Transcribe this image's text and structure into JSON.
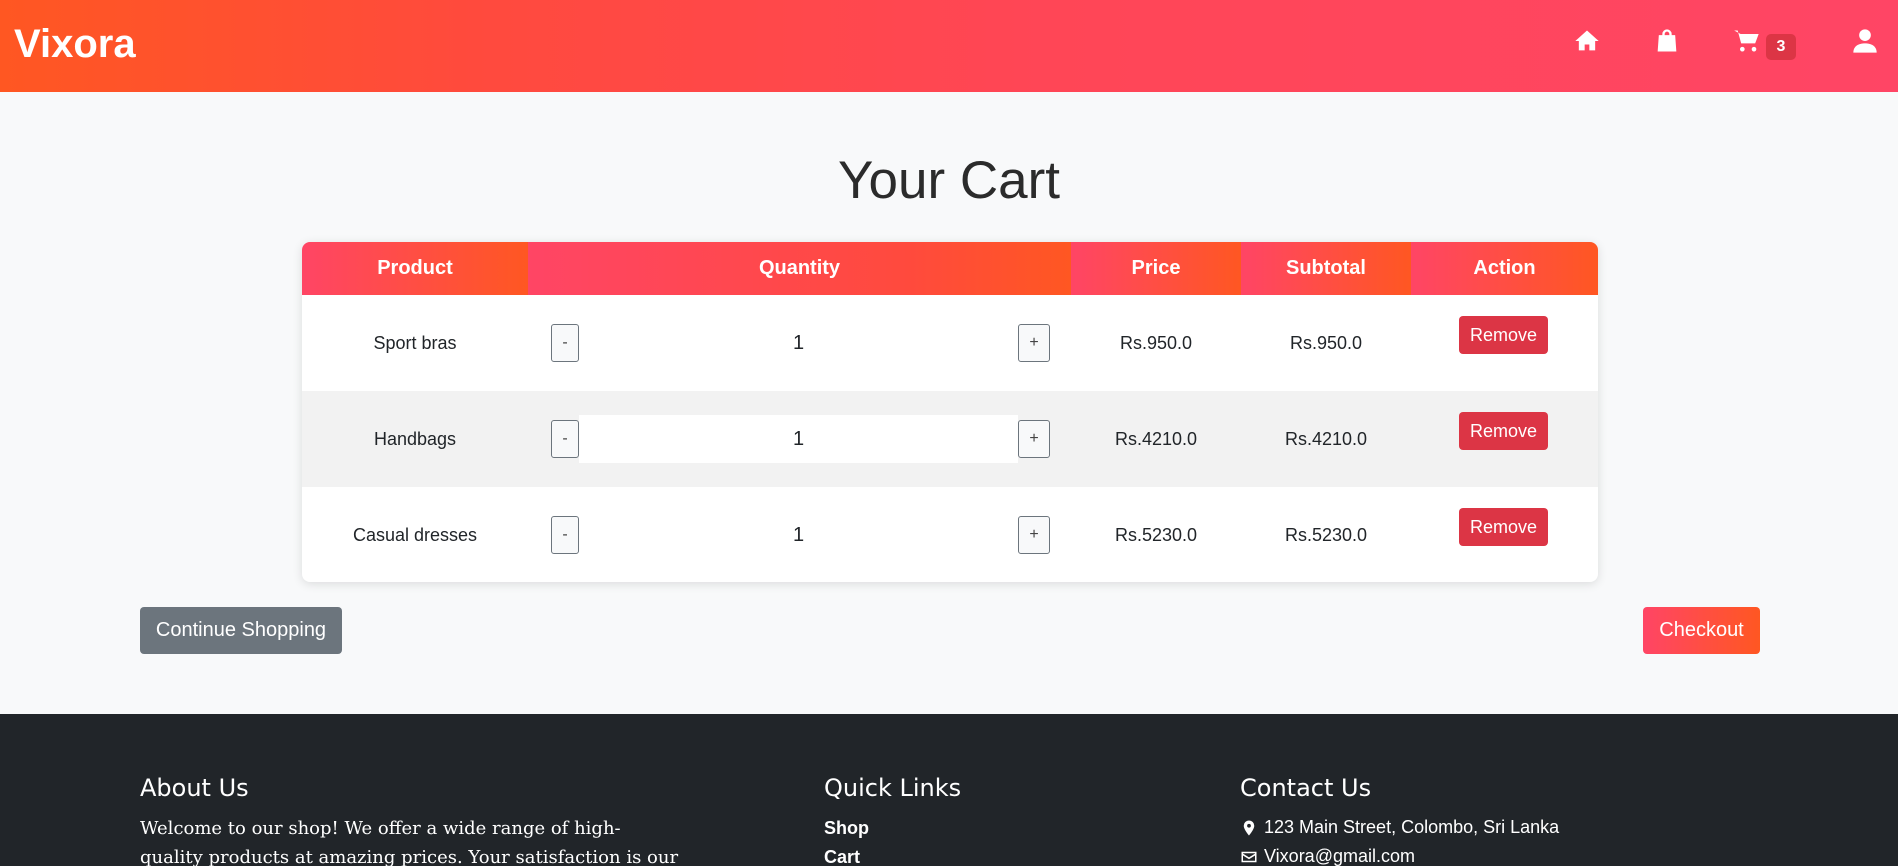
{
  "header": {
    "brand": "Vixora",
    "icons": [
      "home-icon",
      "shopping-bag-icon",
      "cart-icon",
      "user-icon"
    ],
    "cart_count": "3"
  },
  "page": {
    "title": "Your Cart"
  },
  "table": {
    "headers": {
      "product": "Product",
      "quantity": "Quantity",
      "price": "Price",
      "subtotal": "Subtotal",
      "action": "Action"
    },
    "rows": [
      {
        "product": "Sport bras",
        "quantity": "1",
        "price": "Rs.950.0",
        "subtotal": "Rs.950.0",
        "remove": "Remove",
        "minus": "-",
        "plus": "+"
      },
      {
        "product": "Handbags",
        "quantity": "1",
        "price": "Rs.4210.0",
        "subtotal": "Rs.4210.0",
        "remove": "Remove",
        "minus": "-",
        "plus": "+"
      },
      {
        "product": "Casual dresses",
        "quantity": "1",
        "price": "Rs.5230.0",
        "subtotal": "Rs.5230.0",
        "remove": "Remove",
        "minus": "-",
        "plus": "+"
      }
    ]
  },
  "actions": {
    "continue": "Continue Shopping",
    "checkout": "Checkout"
  },
  "footer": {
    "about": {
      "title": "About Us",
      "text": "Welcome to our shop! We offer a wide range of high-quality products at amazing prices. Your satisfaction is our priority."
    },
    "links": {
      "title": "Quick Links",
      "items": [
        "Shop",
        "Cart"
      ]
    },
    "contact": {
      "title": "Contact Us",
      "address": "123 Main Street, Colombo, Sri Lanka",
      "email": "Vixora@gmail.com"
    }
  },
  "colors": {
    "accent_start": "#ff5722",
    "accent_end": "#ff4565",
    "danger": "#dc3545",
    "secondary": "#6c757d",
    "footer": "#212529"
  }
}
